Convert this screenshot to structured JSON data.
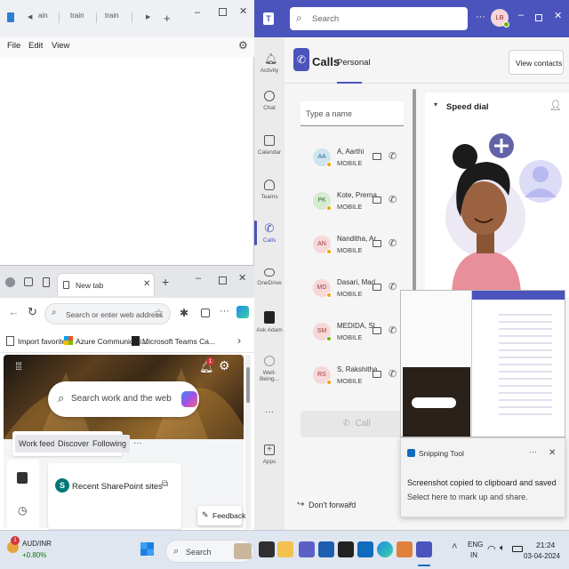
{
  "notepad": {
    "tabs": [
      "ain",
      "train",
      "train"
    ],
    "menu": [
      "File",
      "Edit",
      "View"
    ]
  },
  "edge": {
    "tab_title": "New tab",
    "address_placeholder": "Search or enter web address",
    "favorites": [
      "Import favorites",
      "Azure Communicati...",
      "Microsoft Teams Ca..."
    ],
    "search_placeholder": "Search work and the web",
    "feed_tabs": [
      "Work feed",
      "Discover",
      "Following"
    ],
    "more": "···",
    "card_title": "Recent SharePoint sites",
    "feedback": "Feedback",
    "notification_count": "1"
  },
  "teams": {
    "search_placeholder": "Search",
    "avatar_initials": "LB",
    "rail": [
      "Activity",
      "Chat",
      "Calendar",
      "Teams",
      "Calls",
      "OneDrive",
      "Ask Adam",
      "Well-Being...",
      "Apps"
    ],
    "more": "···",
    "calls_title": "Calls",
    "tab_personal": "Personal",
    "view_contacts": "View contacts",
    "name_placeholder": "Type a name",
    "speed_dial": "Speed dial",
    "contacts": [
      {
        "initials": "AA",
        "name": "A, Aarthi",
        "sub": "MOBILE",
        "bg": "#cfe4f1",
        "fg": "#2b6a8e"
      },
      {
        "initials": "PK",
        "name": "Kote, Prerna",
        "sub": "MOBILE",
        "bg": "#d6ead2",
        "fg": "#3c6b32"
      },
      {
        "initials": "AN",
        "name": "Nanditha, Ar...",
        "sub": "MOBILE",
        "bg": "#f6d8d8",
        "fg": "#a33c3c"
      },
      {
        "initials": "MD",
        "name": "Dasari, Mad...",
        "sub": "MOBILE",
        "bg": "#f6d8d8",
        "fg": "#a33c3c"
      },
      {
        "initials": "SM",
        "name": "MEDIDA, Sl...",
        "sub": "MOBILE",
        "bg": "#f6d8d8",
        "fg": "#a33c3c"
      },
      {
        "initials": "RS",
        "name": "S, Rakshitha",
        "sub": "MOBILE",
        "bg": "#f6d8d8",
        "fg": "#a33c3c"
      }
    ],
    "call_label": "Call",
    "dont_forward": "Don't forward",
    "accent": "#4b53bc"
  },
  "snipping": {
    "app": "Snipping Tool",
    "more": "···",
    "line1": "Screenshot copied to clipboard and saved",
    "line2": "Select here to mark up and share."
  },
  "taskbar": {
    "stock_name": "AUD/INR",
    "stock_change": "+0.80%",
    "stock_badge": "1",
    "search": "Search",
    "lang1": "ENG",
    "lang2": "IN",
    "time": "21:24",
    "date": "03-04-2024"
  }
}
